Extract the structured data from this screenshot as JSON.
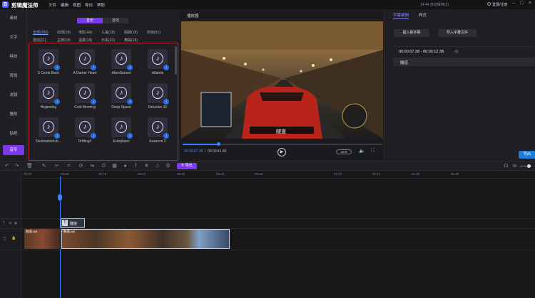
{
  "app": {
    "name": "剪辑魔法师",
    "menus": [
      "文件",
      "编辑",
      "视图",
      "导出",
      "帮助"
    ],
    "status": "14:44 自动保存(2)",
    "login": "登录/注册"
  },
  "sidebar": {
    "items": [
      "素材",
      "文字",
      "特效",
      "转场",
      "滤镜",
      "叠附",
      "贴纸",
      "音乐"
    ],
    "active": "音乐"
  },
  "media": {
    "toggles": [
      "音乐",
      "音效"
    ],
    "categories_row1": [
      "全部(300)",
      "动感(18)",
      "电影(48)",
      "儿童(18)",
      "假期(18)",
      "欢快(81)"
    ],
    "categories_row2": [
      "激动(11)",
      "古典(18)",
      "温柔(18)",
      "日系(20)",
      "舞曲(18)"
    ],
    "tracks": [
      "5 Cents Back",
      "A Darker Heart",
      "AlienSunset",
      "Atlantis",
      "Beginning",
      "Cold Morning",
      "Deep Space",
      "Delusion 32",
      "DestinationUn...",
      "Drifting2",
      "Ectoplasm",
      "Essence 2"
    ]
  },
  "player": {
    "title": "播放器",
    "subtitle_overlay": "隧道",
    "current_time": "00:00:07.38",
    "total_time": "00:00:41.80",
    "aspect": "16:9",
    "progress": 0.18
  },
  "subtitle_panel": {
    "tabs": [
      "字幕编辑",
      "样式"
    ],
    "insert_btn": "插入新字幕",
    "import_btn": "导入字幕文件",
    "range": "00:00:07.38 - 00:00:12.38",
    "text": "隧道",
    "export_btn": "导出"
  },
  "toolbar": {
    "export_label": "导出"
  },
  "timeline": {
    "ticks": [
      "00:00",
      "00:08",
      "00:16",
      "00:24",
      "00:32",
      "00:40",
      "00:48",
      "01:04",
      "01:12",
      "01:20",
      "01:28"
    ],
    "subtitle_clip": "隧道",
    "video_clips": [
      "隧道.avi",
      "隧道.avi"
    ]
  },
  "colors": {
    "accent": "#7c3aed",
    "playhead": "#3b82f6",
    "selection": "#b1282d"
  }
}
